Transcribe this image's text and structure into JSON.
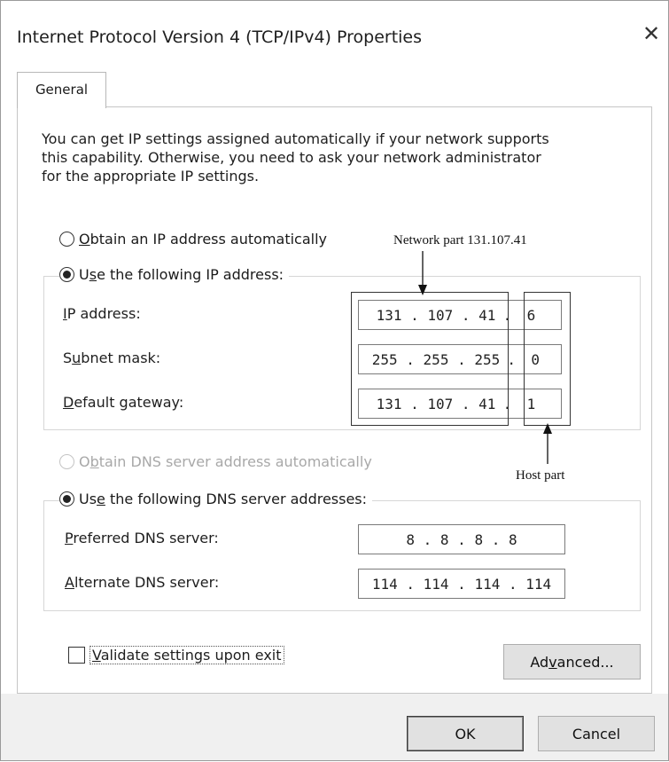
{
  "window": {
    "title": "Internet Protocol Version 4 (TCP/IPv4) Properties",
    "close_glyph": "✕"
  },
  "tabs": [
    {
      "label": "General"
    }
  ],
  "description": "You can get IP settings assigned automatically if your network supports\nthis capability. Otherwise, you need to ask your network administrator\nfor the appropriate IP settings.",
  "ip_section": {
    "auto_option": {
      "prefix": "",
      "accel": "O",
      "rest": "btain an IP address automatically",
      "selected": false
    },
    "manual_option": {
      "prefix": "U",
      "accel": "s",
      "rest": "e the following IP address:",
      "selected": true
    },
    "fields": [
      {
        "prefix": "",
        "accel": "I",
        "rest": "P address:",
        "network_value": "131 . 107 . 41",
        "host_value": "6"
      },
      {
        "prefix": "S",
        "accel": "u",
        "rest": "bnet mask:",
        "network_value": "255 . 255 . 255",
        "host_value": "0"
      },
      {
        "prefix": "",
        "accel": "D",
        "rest": "efault gateway:",
        "network_value": "131 . 107 . 41",
        "host_value": "1"
      }
    ],
    "dot": "."
  },
  "dns_section": {
    "auto_option": {
      "prefix": "O",
      "accel": "b",
      "rest": "tain DNS server address automatically",
      "selected": false,
      "disabled": true
    },
    "manual_option": {
      "prefix": "Us",
      "accel": "e",
      "rest": " the following DNS server addresses:",
      "selected": true
    },
    "fields": [
      {
        "prefix": "",
        "accel": "P",
        "rest": "referred DNS server:",
        "value": "8 . 8 . 8 . 8"
      },
      {
        "prefix": "",
        "accel": "A",
        "rest": "lternate DNS server:",
        "value": "114 . 114 . 114 . 114"
      }
    ]
  },
  "annotations": {
    "network_part": "Network part 131.107.41",
    "host_part": "Host part"
  },
  "validate": {
    "prefix": "",
    "accel": "V",
    "rest": "alidate settings upon exit",
    "checked": false
  },
  "buttons": {
    "advanced": {
      "prefix": "Ad",
      "accel": "v",
      "rest": "anced..."
    },
    "ok": "OK",
    "cancel": "Cancel"
  },
  "colors": {
    "window_bg": "#ffffff",
    "footer_bg": "#f0f0f0",
    "button_bg": "#e1e1e1",
    "disabled_text": "#a8a8a8"
  }
}
